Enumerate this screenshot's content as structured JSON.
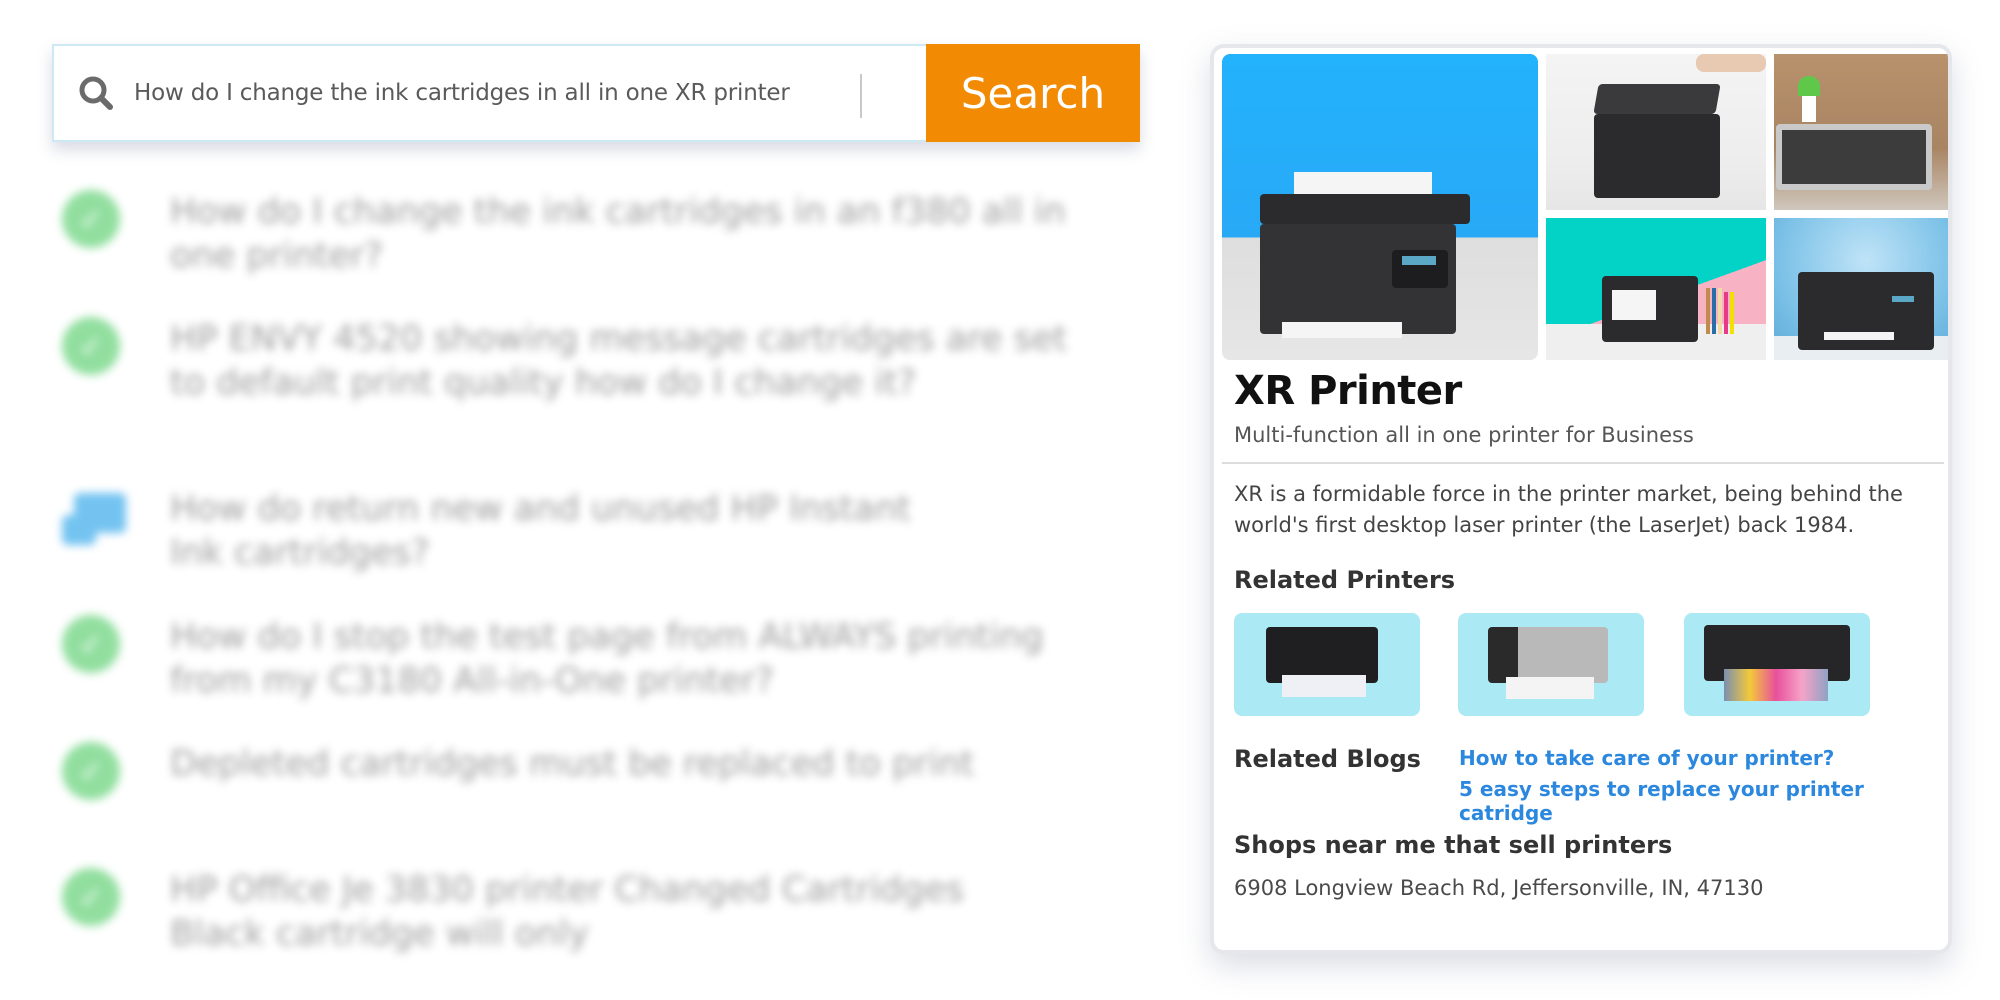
{
  "search": {
    "query": "How do I change the ink cartridges in all in one XR printer",
    "button_label": "Search",
    "icon": "search-icon"
  },
  "suggestions": [
    {
      "icon": "check-circle-icon",
      "text": "How do I change the ink cartridges in an f380 all in one printer?"
    },
    {
      "icon": "check-circle-icon",
      "text": "HP ENVY 4520 showing message cartridges are set to  default print quality how do I change it?"
    },
    {
      "icon": "chat-bubbles-icon",
      "text": "How do return new and unused HP Instant Ink cartridges?"
    },
    {
      "icon": "check-circle-icon",
      "text": "How do I stop the test page from ALWAYS printing from my C3180 All-in-One printer?"
    },
    {
      "icon": "check-circle-icon",
      "text": "Depleted cartridges must be replaced to print"
    },
    {
      "icon": "check-circle-icon",
      "text": "HP Office Je 3830 printer Changed Cartridges Black cartridge will only"
    }
  ],
  "card": {
    "gallery": [
      {
        "name": "printer-photo-main"
      },
      {
        "name": "printer-photo-scanning"
      },
      {
        "name": "printer-photo-desk-plant"
      },
      {
        "name": "printer-photo-teal-pink"
      },
      {
        "name": "printer-photo-blue"
      }
    ],
    "title": "XR Printer",
    "subtitle": "Multi-function all in one printer for Business",
    "description": "XR is a formidable force in the printer market, being behind the world's first desktop laser printer (the LaserJet) back 1984.",
    "related_printers_heading": "Related Printers",
    "related_printers": [
      {
        "name": "black-laser-printer"
      },
      {
        "name": "silver-laser-printer"
      },
      {
        "name": "inkjet-photo-printer"
      }
    ],
    "related_blogs_heading": "Related Blogs",
    "related_blogs": [
      "How to take care of your printer?",
      "5 easy steps to replace your printer catridge"
    ],
    "shops_heading": "Shops near me that sell printers",
    "shop_address": "6908 Longview Beach Rd, Jeffersonville, IN, 47130"
  },
  "colors": {
    "search_button": "#f38a04",
    "link": "#2b88de",
    "check": "#7ed98e",
    "chat": "#5ab8ee",
    "related_bg": "#abeaf5"
  }
}
